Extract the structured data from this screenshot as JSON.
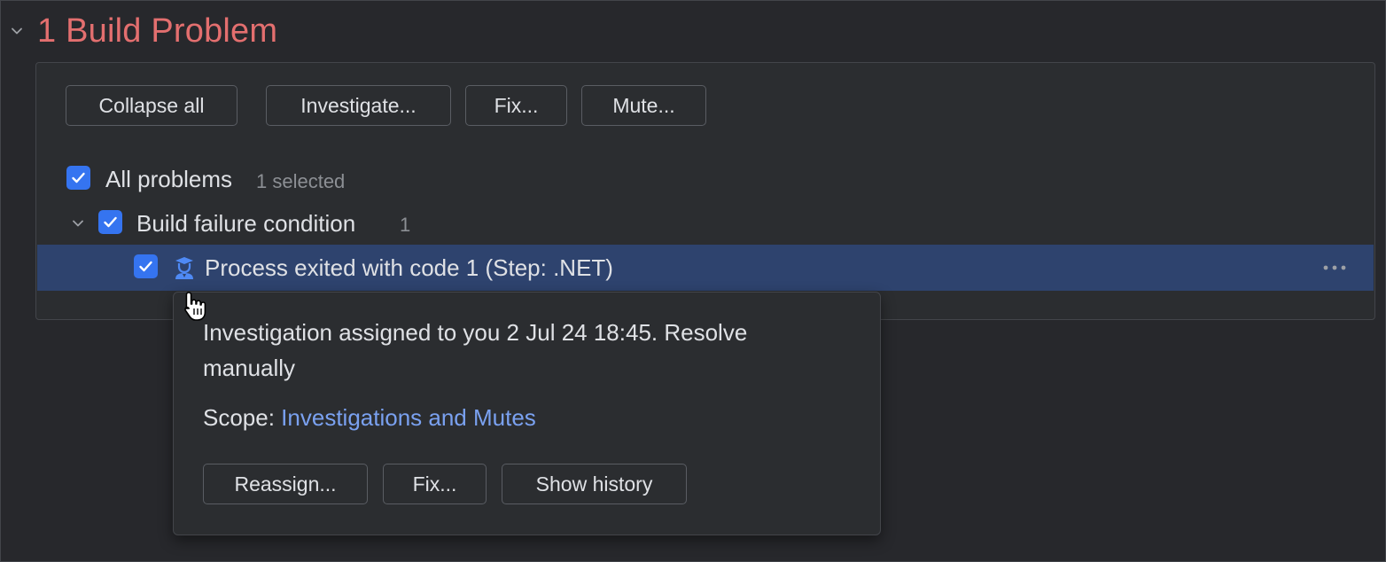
{
  "section": {
    "title": "1 Build Problem"
  },
  "toolbar": {
    "collapse_all": "Collapse all",
    "investigate": "Investigate...",
    "fix": "Fix...",
    "mute": "Mute..."
  },
  "tree": {
    "root": {
      "label": "All problems",
      "selected_count": "1 selected",
      "checked": true
    },
    "group": {
      "label": "Build failure condition",
      "count": "1",
      "checked": true,
      "expanded": true
    },
    "item": {
      "label": "Process exited with code 1 (Step: .NET)",
      "checked": true,
      "icon": "investigator-icon",
      "more_icon": "more-horizontal-icon"
    }
  },
  "popup": {
    "line1": "Investigation assigned to you 2 Jul 24 18:45. Resolve",
    "line2": "manually",
    "scope_label": "Scope: ",
    "scope_link": "Investigations and Mutes",
    "reassign": "Reassign...",
    "fix": "Fix...",
    "show_history": "Show history"
  },
  "colors": {
    "background": "#27282c",
    "panel": "#2b2d30",
    "title_error": "#e36f6f",
    "accent": "#3574f0",
    "link": "#7aa1f0",
    "selection": "#2e436e"
  }
}
